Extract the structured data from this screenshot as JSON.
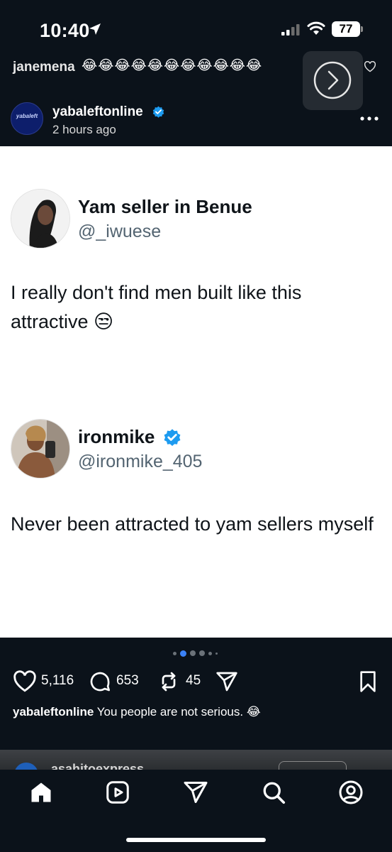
{
  "status_bar": {
    "time": "10:40",
    "battery": "77"
  },
  "comment_banner": {
    "user": "janemena",
    "emojis": "😂😂😂😂😂😂😂😂😂😂😂"
  },
  "post": {
    "username": "yabaleftonline",
    "avatar_text": "yabaleft",
    "time_ago": "2 hours ago",
    "tweets": [
      {
        "name": "Yam seller in Benue",
        "handle": "@_iwuese",
        "verified": false,
        "text": "I really don't find men built like this attractive 😒"
      },
      {
        "name": "ironmike",
        "handle": "@ironmike_405",
        "verified": true,
        "text": "Never been attracted to yam sellers myself"
      }
    ],
    "carousel": {
      "count": 6,
      "active_index": 1
    },
    "likes": "5,116",
    "comments": "653",
    "reposts": "45",
    "caption_user": "yabaleftonline",
    "caption_text": "You people are not serious. 😂"
  },
  "next_post": {
    "username": "asahitoexpress"
  },
  "colors": {
    "background": "#0b121a",
    "verified": "#1d9bf0",
    "panel": "#ffffff",
    "active_dot": "#3b82f6"
  },
  "nav": [
    "home-icon",
    "reels-icon",
    "direct-icon",
    "search-icon",
    "profile-icon"
  ]
}
